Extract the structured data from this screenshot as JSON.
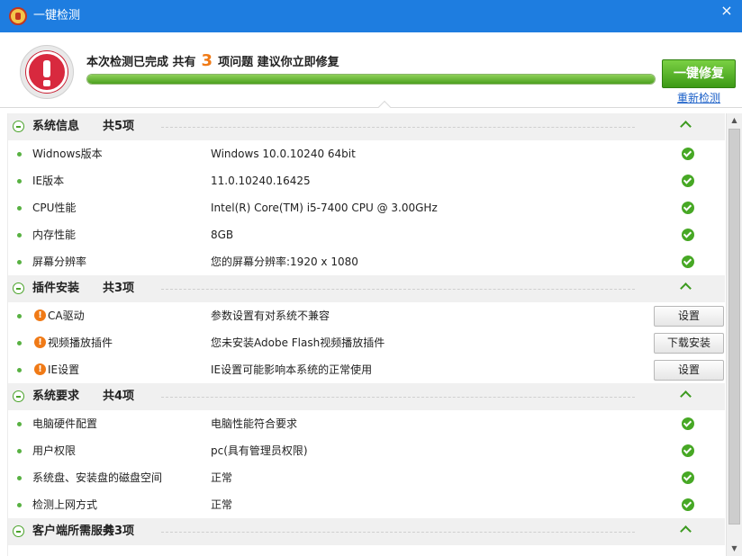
{
  "window": {
    "title": "一键检测",
    "close_glyph": "×"
  },
  "summary": {
    "prefix": "本次检测已完成 共有",
    "count": "3",
    "suffix": "项问题 建议你立即修复",
    "progress": 1.0
  },
  "actions": {
    "fix_label": "一键修复",
    "recheck_label": "重新检测"
  },
  "sections": [
    {
      "title": "系统信息",
      "count": "共5项",
      "items": [
        {
          "name": "Widnows版本",
          "value": "Windows   10.0.10240  64bit",
          "status": "ok"
        },
        {
          "name": "IE版本",
          "value": "11.0.10240.16425",
          "status": "ok"
        },
        {
          "name": "CPU性能",
          "value": "Intel(R) Core(TM) i5-7400 CPU @ 3.00GHz",
          "status": "ok"
        },
        {
          "name": "内存性能",
          "value": "8GB",
          "status": "ok"
        },
        {
          "name": "屏幕分辨率",
          "value": "您的屏幕分辨率:1920 x 1080",
          "status": "ok"
        }
      ]
    },
    {
      "title": "插件安装",
      "count": "共3项",
      "items": [
        {
          "name": "CA驱动",
          "value": "参数设置有对系统不兼容",
          "status": "warn",
          "action": "设置"
        },
        {
          "name": "视频播放插件",
          "value": "您未安装Adobe Flash视频播放插件",
          "status": "warn",
          "action": "下载安装"
        },
        {
          "name": "IE设置",
          "value": "IE设置可能影响本系统的正常使用",
          "status": "warn",
          "action": "设置"
        }
      ]
    },
    {
      "title": "系统要求",
      "count": "共4项",
      "items": [
        {
          "name": "电脑硬件配置",
          "value": "电脑性能符合要求",
          "status": "ok"
        },
        {
          "name": "用户权限",
          "value": "pc(具有管理员权限)",
          "status": "ok"
        },
        {
          "name": "系统盘、安装盘的磁盘空间",
          "value": "正常",
          "status": "ok"
        },
        {
          "name": "检测上网方式",
          "value": "正常",
          "status": "ok"
        }
      ]
    },
    {
      "title": "客户端所需服务",
      "count": "共3项",
      "items": []
    }
  ],
  "icons": {
    "app": "app-emblem-icon",
    "alert": "alert-exclamation-icon",
    "ok": "check-circle-icon",
    "warn": "warning-icon",
    "collapse": "collapse-minus-icon",
    "chevron": "chevron-up-icon"
  },
  "colors": {
    "titlebar": "#1e7de0",
    "accent_green": "#4ca11f",
    "warn_orange": "#f07a16",
    "alert_red": "#d8293e",
    "link_blue": "#1a5fc8"
  }
}
